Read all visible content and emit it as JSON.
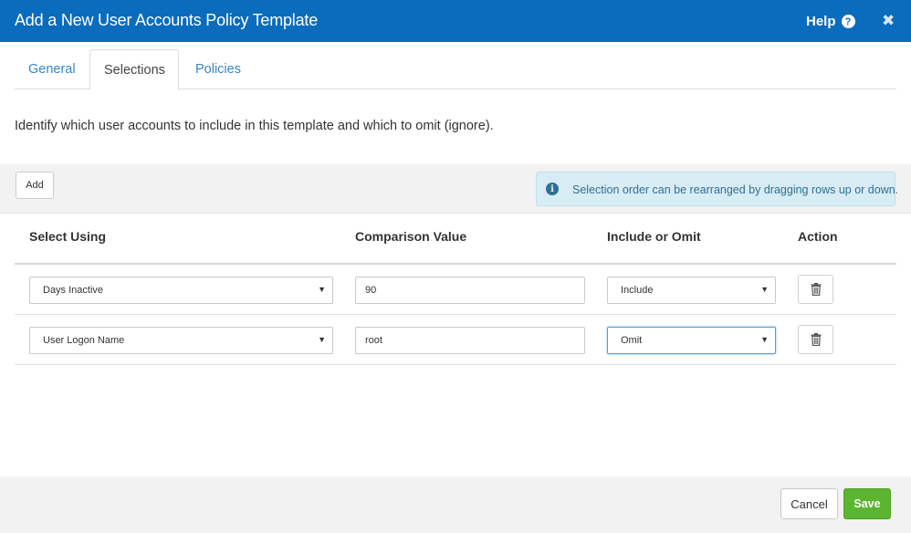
{
  "dialog": {
    "title": "Add a New User Accounts Policy Template",
    "help_label": "Help",
    "help_icon": "question-circle-icon",
    "close_icon": "close-icon"
  },
  "tabs": [
    {
      "label": "General",
      "active": false
    },
    {
      "label": "Selections",
      "active": true
    },
    {
      "label": "Policies",
      "active": false
    }
  ],
  "intro_text": "Identify which user accounts to include in this template and which to omit (ignore).",
  "toolbar": {
    "add_label": "Add",
    "info_icon": "info-circle-icon",
    "info_text": "Selection order can be rearranged by dragging rows up or down."
  },
  "table": {
    "columns": [
      "Select Using",
      "Comparison Value",
      "Include or Omit",
      "Action"
    ],
    "rows": [
      {
        "select_using": "Days Inactive",
        "comparison_value": "90",
        "include_or_omit": "Include",
        "action_icon": "trash-icon"
      },
      {
        "select_using": "User Logon Name",
        "comparison_value": "root",
        "include_or_omit": "Omit",
        "action_icon": "trash-icon"
      }
    ]
  },
  "footer": {
    "cancel_label": "Cancel",
    "save_label": "Save"
  },
  "colors": {
    "titlebar": "#0a6cbc",
    "tab_link": "#3a86c4",
    "info_bg": "#d8ecf5",
    "info_text": "#31708f",
    "save_button": "#5cb531"
  }
}
